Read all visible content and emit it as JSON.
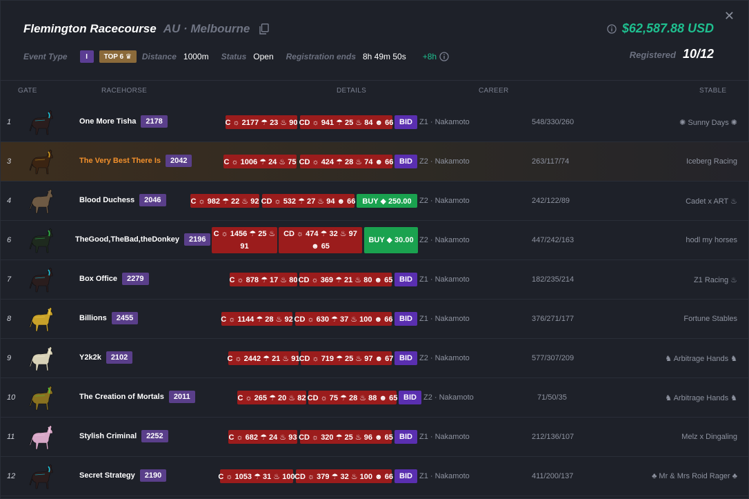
{
  "header": {
    "close_label": "✕",
    "title": "Flemington Racecourse",
    "location": "AU · Melbourne",
    "prize": "$62,587.88 USD",
    "event_type_label": "Event Type",
    "event_class": "I",
    "top_badge": "TOP 6 ♛",
    "distance_label": "Distance",
    "distance": "1000m",
    "status_label": "Status",
    "status": "Open",
    "reg_ends_label": "Registration ends",
    "reg_ends": "8h 49m 50s",
    "extend": "+8h",
    "registered_label": "Registered",
    "registered": "10/12"
  },
  "columns": {
    "gate": "GATE",
    "racehorse": "RACEHORSE",
    "details": "DETAILS",
    "career": "CAREER",
    "stable": "STABLE"
  },
  "colors": {
    "accent_green": "#1fbf8f",
    "chip_red": "#9b1c1c",
    "bid_purple": "#5a2fb0",
    "buy_green": "#1aa24f",
    "rating_purple": "#5a3f8a",
    "highlight_orange": "#f2902c"
  },
  "rows": [
    {
      "gate": "1",
      "name": "One More Tisha",
      "rating": "2178",
      "c": "C ☼ 2177 ☂ 23 ♨ 90",
      "cd": "CD ☼ 941 ☂ 25 ♨ 84 ☻ 66",
      "action": "BID",
      "zone": "Z1 · Nakamoto",
      "career": "548/330/260",
      "stable": "✺ Sunny Days ✺",
      "horse_color": "#2a1d1d",
      "accent": "#19c8e0",
      "highlight": false
    },
    {
      "gate": "3",
      "name": "The Very Best There Is",
      "rating": "2042",
      "c": "C ☼ 1006 ☂ 24 ♨ 75",
      "cd": "CD ☼ 424 ☂ 28 ♨ 74 ☻ 66",
      "action": "BID",
      "zone": "Z2 · Nakamoto",
      "career": "263/117/74",
      "stable": "Iceberg Racing",
      "horse_color": "#3b2412",
      "accent": "#d4a020",
      "highlight": true
    },
    {
      "gate": "4",
      "name": "Blood Duchess",
      "rating": "2046",
      "c": "C ☼ 982 ☂ 22 ♨ 92",
      "cd": "CD ☼ 532 ☂ 27 ♨ 94 ☻ 66",
      "action": "BUY ◆ 250.00",
      "zone": "Z2 · Nakamoto",
      "career": "242/122/89",
      "stable": "Cadet x ART ♨",
      "horse_color": "#6e5a44",
      "accent": "#6e5a44",
      "highlight": false
    },
    {
      "gate": "6",
      "name": "TheGood,TheBad,theDonkey",
      "rating": "2196",
      "c": "C ☼ 1456 ☂ 25 ♨ 91",
      "cd": "CD ☼ 474 ☂ 32 ♨ 97 ☻ 65",
      "action": "BUY ◆ 30.00",
      "zone": "Z2 · Nakamoto",
      "career": "447/242/163",
      "stable": "hodl my horses",
      "horse_color": "#1e2a1e",
      "accent": "#2fb84a",
      "highlight": false
    },
    {
      "gate": "7",
      "name": "Box Office",
      "rating": "2279",
      "c": "C ☼ 878 ☂ 17 ♨ 80",
      "cd": "CD ☼ 369 ☂ 21 ♨ 80 ☻ 65",
      "action": "BID",
      "zone": "Z1 · Nakamoto",
      "career": "182/235/214",
      "stable": "Z1 Racing ♨",
      "horse_color": "#2a1d1d",
      "accent": "#19c8e0",
      "highlight": false
    },
    {
      "gate": "8",
      "name": "Billions",
      "rating": "2455",
      "c": "C ☼ 1144 ☂ 28 ♨ 92",
      "cd": "CD ☼ 630 ☂ 37 ♨ 100 ☻ 66",
      "action": "BID",
      "zone": "Z1 · Nakamoto",
      "career": "376/271/177",
      "stable": "Fortune Stables",
      "horse_color": "#c9a22a",
      "accent": "#e8c84a",
      "highlight": false
    },
    {
      "gate": "9",
      "name": "Y2k2k",
      "rating": "2102",
      "c": "C ☼ 2442 ☂ 21 ♨ 91",
      "cd": "CD ☼ 719 ☂ 25 ♨ 97 ☻ 67",
      "action": "BID",
      "zone": "Z2 · Nakamoto",
      "career": "577/307/209",
      "stable": "♞ Arbitrage Hands ♞",
      "horse_color": "#d8d2b8",
      "accent": "#f0ead0",
      "highlight": false
    },
    {
      "gate": "10",
      "name": "The Creation of Mortals",
      "rating": "2011",
      "c": "C ☼ 265 ☂ 20 ♨ 82",
      "cd": "CD ☼ 75 ☂ 28 ♨ 88 ☻ 65",
      "action": "BID",
      "zone": "Z2 · Nakamoto",
      "career": "71/50/35",
      "stable": "♞ Arbitrage Hands ♞",
      "horse_color": "#8a7220",
      "accent": "#4fc83a",
      "highlight": false
    },
    {
      "gate": "11",
      "name": "Stylish Criminal",
      "rating": "2252",
      "c": "C ☼ 682 ☂ 24 ♨ 93",
      "cd": "CD ☼ 320 ☂ 25 ♨ 96 ☻ 65",
      "action": "BID",
      "zone": "Z1 · Nakamoto",
      "career": "212/136/107",
      "stable": "Melz x Dingaling",
      "horse_color": "#d8a8c8",
      "accent": "#f0c8e0",
      "highlight": false
    },
    {
      "gate": "12",
      "name": "Secret Strategy",
      "rating": "2190",
      "c": "C ☼ 1053 ☂ 31 ♨ 100",
      "cd": "CD ☼ 379 ☂ 32 ♨ 100 ☻ 66",
      "action": "BID",
      "zone": "Z1 · Nakamoto",
      "career": "411/200/137",
      "stable": "♣ Mr & Mrs Roid Rager ♣",
      "horse_color": "#2a1d1d",
      "accent": "#19c8e0",
      "highlight": false
    }
  ]
}
